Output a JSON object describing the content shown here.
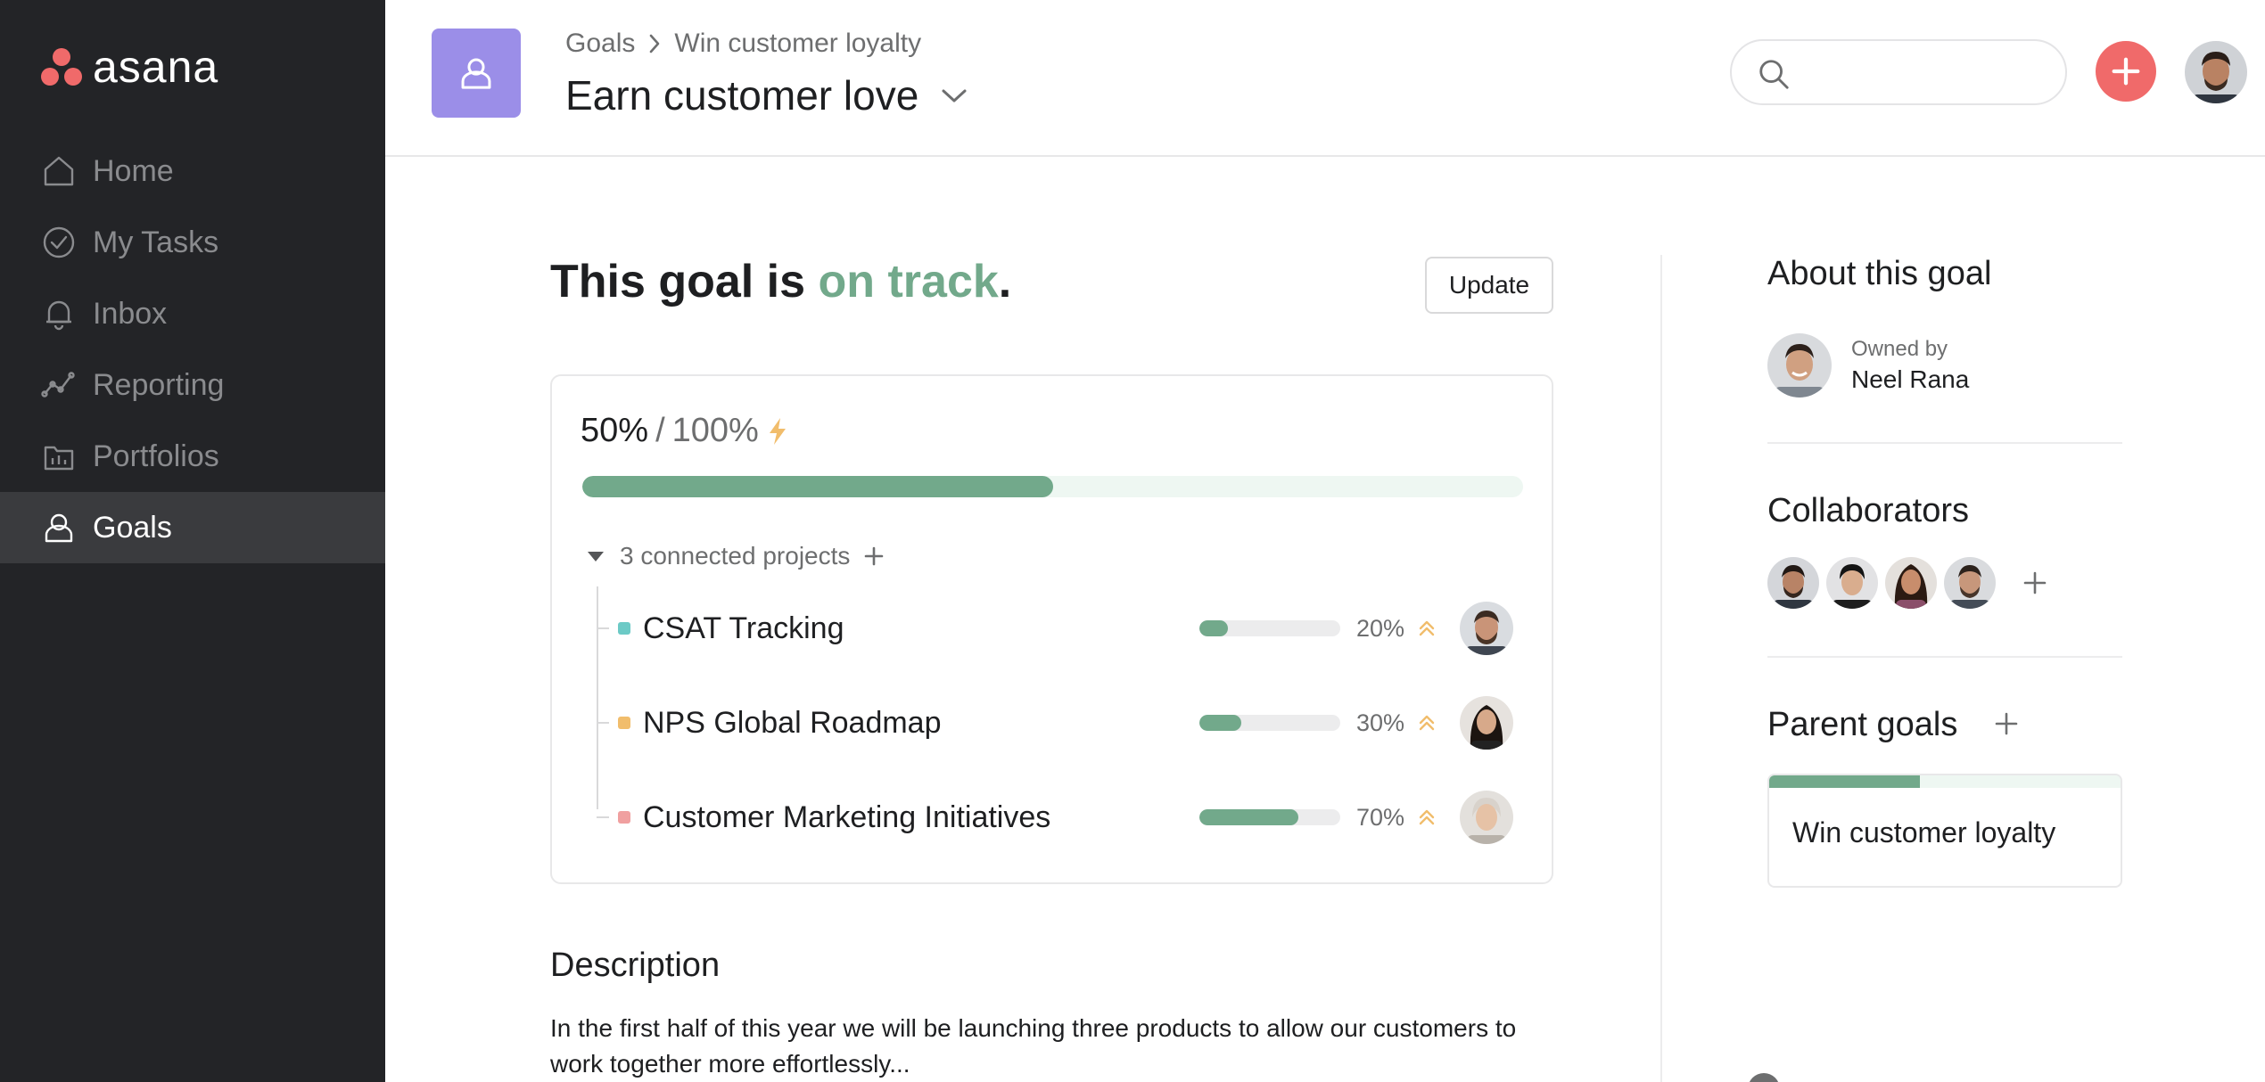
{
  "app": {
    "logo_text": "asana",
    "brand_color": "#f06a6a",
    "accent_color": "#72a98b"
  },
  "sidebar": {
    "items": [
      {
        "label": "Home",
        "icon": "home-icon",
        "active": false
      },
      {
        "label": "My Tasks",
        "icon": "check-circle-icon",
        "active": false
      },
      {
        "label": "Inbox",
        "icon": "bell-icon",
        "active": false
      },
      {
        "label": "Reporting",
        "icon": "line-chart-icon",
        "active": false
      },
      {
        "label": "Portfolios",
        "icon": "portfolio-icon",
        "active": false
      },
      {
        "label": "Goals",
        "icon": "goals-icon",
        "active": true
      }
    ]
  },
  "header": {
    "breadcrumb": [
      "Goals",
      "Win customer loyalty"
    ],
    "title": "Earn customer love",
    "search_placeholder": ""
  },
  "goal": {
    "status_prefix": "This goal is ",
    "status_value": "on track",
    "status_suffix": ".",
    "update_label": "Update",
    "current_pct": "50%",
    "target_pct": "100%",
    "progress_fraction": 0.5,
    "connected_label": "3 connected projects"
  },
  "projects": [
    {
      "name": "CSAT Tracking",
      "pct_label": "20%",
      "fraction": 0.2,
      "color": "#6ccac6"
    },
    {
      "name": "NPS Global Roadmap",
      "pct_label": "30%",
      "fraction": 0.3,
      "color": "#f1bd6c"
    },
    {
      "name": "Customer Marketing Initiatives",
      "pct_label": "70%",
      "fraction": 0.7,
      "color": "#f0a0a0"
    }
  ],
  "description": {
    "title": "Description",
    "text": "In the first half of this year we will be launching three products to allow our customers to work together more effortlessly..."
  },
  "about": {
    "title": "About this goal",
    "owner_label": "Owned by",
    "owner_name": "Neel Rana",
    "collaborators_title": "Collaborators",
    "parent_goals_title": "Parent goals",
    "parent_goal_name": "Win customer loyalty",
    "parent_goal_fraction": 0.43
  }
}
